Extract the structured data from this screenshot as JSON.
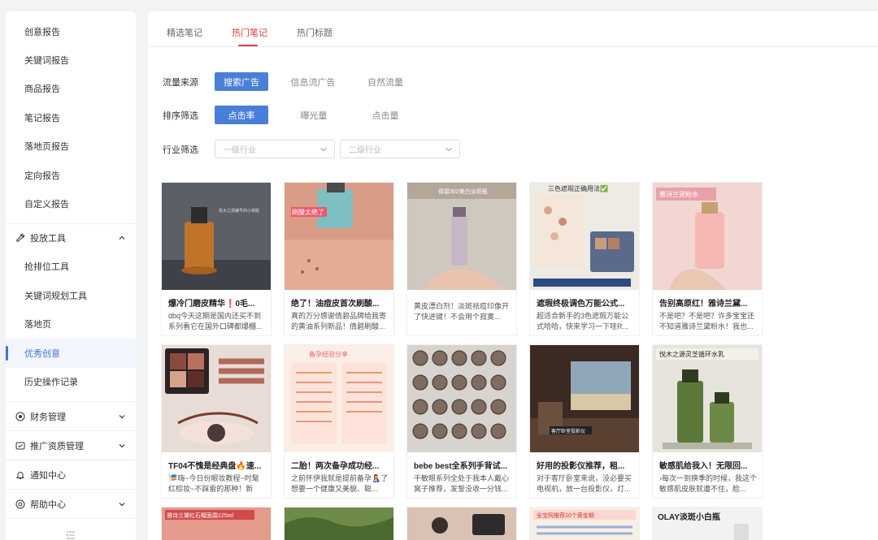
{
  "sidebar": {
    "report_items": [
      "创意报告",
      "关键词报告",
      "商品报告",
      "笔记报告",
      "落地页报告",
      "定向报告",
      "自定义报告"
    ],
    "tools_group": "投放工具",
    "tool_items": [
      "抢排位工具",
      "关键词规划工具",
      "落地页",
      "优秀创意",
      "历史操作记录"
    ],
    "active_item": "优秀创意",
    "finance": "财务管理",
    "qualification": "推广资质管理",
    "notification": "通知中心",
    "help": "帮助中心"
  },
  "tabs": [
    "精选笔记",
    "热门笔记",
    "热门标题"
  ],
  "active_tab": "热门笔记",
  "filters": {
    "traffic_label": "流量来源",
    "traffic_options": [
      "搜索广告",
      "信息流广告",
      "自然流量"
    ],
    "sort_label": "排序筛选",
    "sort_options": [
      "点击率",
      "曝光量",
      "点击量"
    ],
    "industry_label": "行业筛选",
    "industry_level1_placeholder": "一级行业",
    "industry_level2_placeholder": "二级行业"
  },
  "cards_row1": [
    {
      "title": "爆冷门磨皮精华❗️0毛...",
      "desc": "dbq今天这期是国内还买不到系列看它在国外口碑都爆棚...",
      "overlay": "悦木之源编号四小棉瓶"
    },
    {
      "title": "绝了！油痘皮首次刷酸...",
      "desc": "真的万分感谢倩碧品牌给我寄的黄油系列新品！倩碧刷酸...",
      "overlay": "刷酸太绝了"
    },
    {
      "title": "",
      "desc": "黄皮漂白剂！淡斑祛痘印像开了快进键！不会用个寂寞...",
      "overlay": "倩碧302美白淡斑瓶"
    },
    {
      "title": "遮瑕终极调色万能公式...",
      "desc": "超适合新手的3色遮瑕万能公式哈哈，快来学习一下哇R...",
      "overlay": "三色遮瑕正确用法✅"
    },
    {
      "title": "告别高原红！雅诗兰黛...",
      "desc": "不是吧？不是吧？许多宝宝还不知道雅诗兰黛粉水！我也...",
      "overlay": "雅诗兰黛粉水"
    }
  ],
  "cards_row2": [
    {
      "title": "TF04不愧是经典盘🔥速...",
      "desc": "🎏嗨~今日份眼妆教程~时髦红棕妆~不踩雷的那种！新手...",
      "overlay": ""
    },
    {
      "title": "二胎！两次备孕成功经...",
      "desc": "之前怀伊我就是提前备孕🤱了想要一个健康又美貌、聪...",
      "overlay": "备孕经验分享"
    },
    {
      "title": "bebe best全系列手背试...",
      "desc": "干敏眼系列全处于我本人戴心窝子推荐，发誓没收一分钱...",
      "overlay": ""
    },
    {
      "title": "好用的投影仪推荐，租...",
      "desc": "对于客厅卧室来说，没必要买电视机，放一台投影仪，灯...",
      "overlay": "客厅卧室投影仪"
    },
    {
      "title": "敏感肌给我入！无限回...",
      "desc": "›每次一到换季的时候，我这个敏感肌皮肤就遭不住，脸...",
      "overlay": "悦木之源灵芝循环水乳"
    }
  ],
  "cards_row3": [
    {
      "overlay": "雅诗兰黛红石榴面霜125ml"
    },
    {
      "overlay": ""
    },
    {
      "overlay": ""
    },
    {
      "overlay": "全宝网推荐10个黄金期"
    },
    {
      "overlay": "OLAY淡斑小白瓶"
    }
  ],
  "colors": {
    "accent": "#4a7fd9",
    "active_tab": "#e23b3b",
    "sidebar_active": "#3f74d8"
  }
}
